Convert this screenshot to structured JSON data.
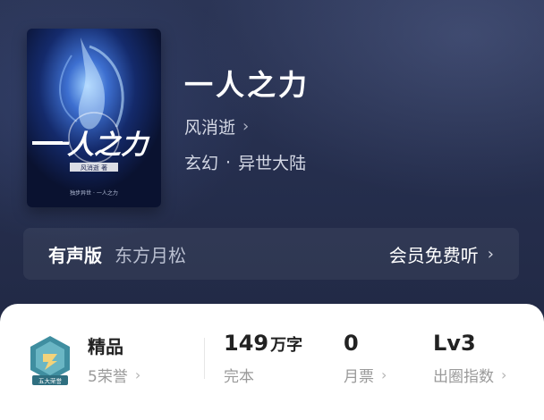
{
  "book": {
    "title": "一人之力",
    "author": "风消逝",
    "genre_primary": "玄幻",
    "genre_separator": "·",
    "genre_secondary": "异世大陆"
  },
  "cover": {
    "title_art": "一人之力",
    "subtitle": "风消逝 著",
    "tagline": "独步异世 · 一人之力"
  },
  "audio": {
    "label": "有声版",
    "narrator": "东方月松",
    "cta": "会员免费听"
  },
  "stats": {
    "honor_title": "精品",
    "honor_sub": "5荣誉",
    "badge_text": "五大荣誉",
    "word_count": "149",
    "word_unit": "万字",
    "status": "完本",
    "monthly_tickets": "0",
    "monthly_tickets_label": "月票",
    "level": "Lv3",
    "level_label": "出圈指数"
  },
  "icons": {
    "author_chevron": "chevron-right-icon",
    "audio_chevron": "chevron-right-icon",
    "badge": "honor-badge-icon"
  },
  "colors": {
    "hero_bg": "#252e4d",
    "card_bg": "#ffffff",
    "badge_teal": "#3f8ea0"
  }
}
